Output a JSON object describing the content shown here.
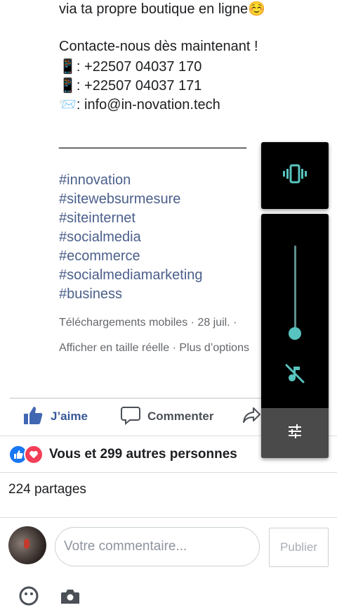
{
  "post": {
    "caption_line1": "via ta propre boutique en ligne",
    "caption_emoji": "☺️",
    "contact_line": "Contacte-nous dès maintenant !",
    "phone1_emoji": "📱",
    "phone1": ": +22507 04037 170",
    "phone2_emoji": "📱",
    "phone2": ": +22507 04037 171",
    "email_emoji": "📨",
    "email": ": info@in-novation.tech",
    "separator": "________________________",
    "hashtags": [
      "#innovation",
      "#sitewebsurmesure",
      "#siteinternet",
      "#socialmedia",
      "#ecommerce",
      "#socialmediamarketing",
      "#business"
    ],
    "meta_line1": "Téléchargements mobiles · 28 juil. ·",
    "meta_line2": "Afficher en taille réelle · Plus d’options"
  },
  "actions": {
    "like_label": "J’aime",
    "comment_label": "Commenter"
  },
  "reactions": {
    "text": "Vous et 299 autres personnes",
    "icons": [
      "thumbs-up-icon",
      "heart-icon"
    ]
  },
  "shares_text": "224 partages",
  "comment_box": {
    "placeholder": "Votre commentaire...",
    "publish_label": "Publier"
  },
  "volume_panel": {
    "level": 0,
    "ringer_mode": "vibrate",
    "accent_color": "#58c4c0",
    "icons": [
      "vibrate-icon",
      "music-off-icon",
      "settings-sliders-icon"
    ]
  },
  "colors": {
    "hashtag": "#4b5f8b",
    "like_blue": "#385898",
    "meta_gray": "#65676b"
  }
}
